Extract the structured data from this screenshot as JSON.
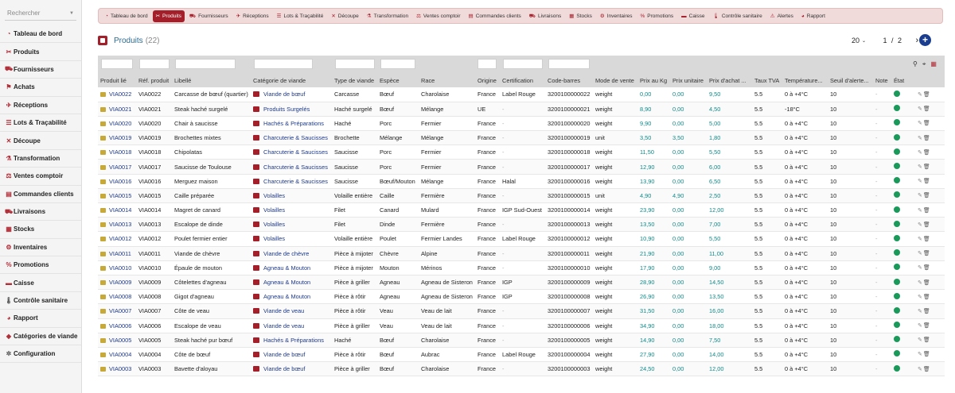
{
  "sidebar": {
    "search_placeholder": "Rechercher",
    "items": [
      {
        "label": "Tableau de bord",
        "icon": "dashboard-icon",
        "glyph": "◔"
      },
      {
        "label": "Produits",
        "icon": "cleaver-icon",
        "glyph": "✂"
      },
      {
        "label": "Fournisseurs",
        "icon": "truck-icon",
        "glyph": "⛟"
      },
      {
        "label": "Achats",
        "icon": "cart-icon",
        "glyph": "⚑"
      },
      {
        "label": "Réceptions",
        "icon": "reception-icon",
        "glyph": "✈"
      },
      {
        "label": "Lots & Traçabilité",
        "icon": "lots-icon",
        "glyph": "☰"
      },
      {
        "label": "Découpe",
        "icon": "cut-icon",
        "glyph": "✕"
      },
      {
        "label": "Transformation",
        "icon": "transformation-icon",
        "glyph": "⚗"
      },
      {
        "label": "Ventes comptoir",
        "icon": "counter-sales-icon",
        "glyph": "⚖"
      },
      {
        "label": "Commandes clients",
        "icon": "orders-icon",
        "glyph": "▤"
      },
      {
        "label": "Livraisons",
        "icon": "delivery-icon",
        "glyph": "⛟"
      },
      {
        "label": "Stocks",
        "icon": "stocks-icon",
        "glyph": "▦"
      },
      {
        "label": "Inventaires",
        "icon": "inventory-icon",
        "glyph": "⚙"
      },
      {
        "label": "Promotions",
        "icon": "percent-icon",
        "glyph": "%"
      },
      {
        "label": "Caisse",
        "icon": "cash-register-icon",
        "glyph": "▬"
      },
      {
        "label": "Contrôle sanitaire",
        "icon": "thermometer-icon",
        "glyph": "🌡"
      },
      {
        "label": "Rapport",
        "icon": "report-icon",
        "glyph": "◕"
      },
      {
        "label": "Catégories de viande",
        "icon": "tags-icon",
        "glyph": "◆"
      },
      {
        "label": "Configuration",
        "icon": "gear-icon",
        "glyph": "✲"
      }
    ]
  },
  "topnav": [
    {
      "label": "Tableau de bord",
      "icon": "dashboard-icon",
      "glyph": "◔"
    },
    {
      "label": "Produits",
      "icon": "cleaver-icon",
      "glyph": "✂",
      "active": true
    },
    {
      "label": "Fournisseurs",
      "icon": "truck-icon",
      "glyph": "⛟"
    },
    {
      "label": "Réceptions",
      "icon": "reception-icon",
      "glyph": "✈"
    },
    {
      "label": "Lots & Traçabilité",
      "icon": "lots-icon",
      "glyph": "☰"
    },
    {
      "label": "Découpe",
      "icon": "cut-icon",
      "glyph": "✕"
    },
    {
      "label": "Transformation",
      "icon": "transformation-icon",
      "glyph": "⚗"
    },
    {
      "label": "Ventes comptoir",
      "icon": "counter-sales-icon",
      "glyph": "⚖"
    },
    {
      "label": "Commandes clients",
      "icon": "orders-icon",
      "glyph": "▤"
    },
    {
      "label": "Livraisons",
      "icon": "delivery-icon",
      "glyph": "⛟"
    },
    {
      "label": "Stocks",
      "icon": "stocks-icon",
      "glyph": "▦"
    },
    {
      "label": "Inventaires",
      "icon": "inventory-icon",
      "glyph": "⚙"
    },
    {
      "label": "Promotions",
      "icon": "percent-icon",
      "glyph": "%"
    },
    {
      "label": "Caisse",
      "icon": "cash-register-icon",
      "glyph": "▬"
    },
    {
      "label": "Contrôle sanitaire",
      "icon": "thermometer-icon",
      "glyph": "🌡"
    },
    {
      "label": "Alertes",
      "icon": "alert-icon",
      "glyph": "⚠"
    },
    {
      "label": "Rapport",
      "icon": "report-icon",
      "glyph": "◕"
    }
  ],
  "page": {
    "title": "Produits",
    "count": "(22)"
  },
  "pagination": {
    "page_size": "20",
    "current_page": "1",
    "separator": "/",
    "total_pages": "2",
    "next_glyph": "›",
    "add_glyph": "+"
  },
  "toolbar": {
    "search_glyph": "⚲",
    "columns_glyph": "⌖",
    "export_glyph": "▦"
  },
  "table": {
    "columns": [
      "Produit lié",
      "Réf. produit",
      "Libellé",
      "Catégorie de viande",
      "Type de viande",
      "Espèce",
      "Race",
      "Origine",
      "Certification",
      "Code-barres",
      "Mode de vente",
      "Prix au Kg",
      "Prix unitaire",
      "Prix d'achat ...",
      "Taux TVA",
      "Température...",
      "Seuil d'alerte...",
      "Note",
      "État",
      ""
    ],
    "rows": [
      [
        "VIA0022",
        "VIA0022",
        "Carcasse de bœuf (quartier)",
        "Viande de bœuf",
        "Carcasse",
        "Bœuf",
        "Charolaise",
        "France",
        "Label Rouge",
        "3200100000022",
        "weight",
        "0,00",
        "0,00",
        "9,50",
        "5.5",
        "0 à +4°C",
        "10",
        "-"
      ],
      [
        "VIA0021",
        "VIA0021",
        "Steak haché surgelé",
        "Produits Surgelés",
        "Haché surgelé",
        "Bœuf",
        "Mélange",
        "UE",
        "-",
        "3200100000021",
        "weight",
        "8,90",
        "0,00",
        "4,50",
        "5.5",
        "-18°C",
        "10",
        "-"
      ],
      [
        "VIA0020",
        "VIA0020",
        "Chair à saucisse",
        "Hachés & Préparations",
        "Haché",
        "Porc",
        "Fermier",
        "France",
        "-",
        "3200100000020",
        "weight",
        "9,90",
        "0,00",
        "5,00",
        "5.5",
        "0 à +4°C",
        "10",
        "-"
      ],
      [
        "VIA0019",
        "VIA0019",
        "Brochettes mixtes",
        "Charcuterie & Saucisses",
        "Brochette",
        "Mélange",
        "Mélange",
        "France",
        "-",
        "3200100000019",
        "unit",
        "3,50",
        "3,50",
        "1,80",
        "5.5",
        "0 à +4°C",
        "10",
        "-"
      ],
      [
        "VIA0018",
        "VIA0018",
        "Chipolatas",
        "Charcuterie & Saucisses",
        "Saucisse",
        "Porc",
        "Fermier",
        "France",
        "-",
        "3200100000018",
        "weight",
        "11,50",
        "0,00",
        "5,50",
        "5.5",
        "0 à +4°C",
        "10",
        "-"
      ],
      [
        "VIA0017",
        "VIA0017",
        "Saucisse de Toulouse",
        "Charcuterie & Saucisses",
        "Saucisse",
        "Porc",
        "Fermier",
        "France",
        "-",
        "3200100000017",
        "weight",
        "12,90",
        "0,00",
        "6,00",
        "5.5",
        "0 à +4°C",
        "10",
        "-"
      ],
      [
        "VIA0016",
        "VIA0016",
        "Merguez maison",
        "Charcuterie & Saucisses",
        "Saucisse",
        "Bœuf/Mouton",
        "Mélange",
        "France",
        "Halal",
        "3200100000016",
        "weight",
        "13,90",
        "0,00",
        "6,50",
        "5.5",
        "0 à +4°C",
        "10",
        "-"
      ],
      [
        "VIA0015",
        "VIA0015",
        "Caille préparée",
        "Volailles",
        "Volaille entière",
        "Caille",
        "Fermière",
        "France",
        "-",
        "3200100000015",
        "unit",
        "4,90",
        "4,90",
        "2,50",
        "5.5",
        "0 à +4°C",
        "10",
        "-"
      ],
      [
        "VIA0014",
        "VIA0014",
        "Magret de canard",
        "Volailles",
        "Filet",
        "Canard",
        "Mulard",
        "France",
        "IGP Sud-Ouest",
        "3200100000014",
        "weight",
        "23,90",
        "0,00",
        "12,00",
        "5.5",
        "0 à +4°C",
        "10",
        "-"
      ],
      [
        "VIA0013",
        "VIA0013",
        "Escalope de dinde",
        "Volailles",
        "Filet",
        "Dinde",
        "Fermière",
        "France",
        "-",
        "3200100000013",
        "weight",
        "13,50",
        "0,00",
        "7,00",
        "5.5",
        "0 à +4°C",
        "10",
        "-"
      ],
      [
        "VIA0012",
        "VIA0012",
        "Poulet fermier entier",
        "Volailles",
        "Volaille entière",
        "Poulet",
        "Fermier Landes",
        "France",
        "Label Rouge",
        "3200100000012",
        "weight",
        "10,90",
        "0,00",
        "5,50",
        "5.5",
        "0 à +4°C",
        "10",
        "-"
      ],
      [
        "VIA0011",
        "VIA0011",
        "Viande de chèvre",
        "Viande de chèvre",
        "Pièce à mijoter",
        "Chèvre",
        "Alpine",
        "France",
        "-",
        "3200100000011",
        "weight",
        "21,90",
        "0,00",
        "11,00",
        "5.5",
        "0 à +4°C",
        "10",
        "-"
      ],
      [
        "VIA0010",
        "VIA0010",
        "Épaule de mouton",
        "Agneau & Mouton",
        "Pièce à mijoter",
        "Mouton",
        "Mérinos",
        "France",
        "-",
        "3200100000010",
        "weight",
        "17,90",
        "0,00",
        "9,00",
        "5.5",
        "0 à +4°C",
        "10",
        "-"
      ],
      [
        "VIA0009",
        "VIA0009",
        "Côtelettes d'agneau",
        "Agneau & Mouton",
        "Pièce à griller",
        "Agneau",
        "Agneau de Sisteron",
        "France",
        "IGP",
        "3200100000009",
        "weight",
        "28,90",
        "0,00",
        "14,50",
        "5.5",
        "0 à +4°C",
        "10",
        "-"
      ],
      [
        "VIA0008",
        "VIA0008",
        "Gigot d'agneau",
        "Agneau & Mouton",
        "Pièce à rôtir",
        "Agneau",
        "Agneau de Sisteron",
        "France",
        "IGP",
        "3200100000008",
        "weight",
        "26,90",
        "0,00",
        "13,50",
        "5.5",
        "0 à +4°C",
        "10",
        "-"
      ],
      [
        "VIA0007",
        "VIA0007",
        "Côte de veau",
        "Viande de veau",
        "Pièce à rôtir",
        "Veau",
        "Veau de lait",
        "France",
        "-",
        "3200100000007",
        "weight",
        "31,50",
        "0,00",
        "16,00",
        "5.5",
        "0 à +4°C",
        "10",
        "-"
      ],
      [
        "VIA0006",
        "VIA0006",
        "Escalope de veau",
        "Viande de veau",
        "Pièce à griller",
        "Veau",
        "Veau de lait",
        "France",
        "-",
        "3200100000006",
        "weight",
        "34,90",
        "0,00",
        "18,00",
        "5.5",
        "0 à +4°C",
        "10",
        "-"
      ],
      [
        "VIA0005",
        "VIA0005",
        "Steak haché pur bœuf",
        "Hachés & Préparations",
        "Haché",
        "Bœuf",
        "Charolaise",
        "France",
        "-",
        "3200100000005",
        "weight",
        "14,90",
        "0,00",
        "7,50",
        "5.5",
        "0 à +4°C",
        "10",
        "-"
      ],
      [
        "VIA0004",
        "VIA0004",
        "Côte de bœuf",
        "Viande de bœuf",
        "Pièce à rôtir",
        "Bœuf",
        "Aubrac",
        "France",
        "Label Rouge",
        "3200100000004",
        "weight",
        "27,90",
        "0,00",
        "14,00",
        "5.5",
        "0 à +4°C",
        "10",
        "-"
      ],
      [
        "VIA0003",
        "VIA0003",
        "Bavette d'aloyau",
        "Viande de bœuf",
        "Pièce à griller",
        "Bœuf",
        "Charolaise",
        "France",
        "-",
        "3200100000003",
        "weight",
        "24,50",
        "0,00",
        "12,00",
        "5.5",
        "0 à +4°C",
        "10",
        "-"
      ]
    ],
    "status_color": "#1a9a5a",
    "edit_glyph": "✎",
    "delete_glyph": "🗑"
  },
  "colors": {
    "accent": "#a3202b",
    "link": "#1e3a8a",
    "number": "#118a8a"
  }
}
